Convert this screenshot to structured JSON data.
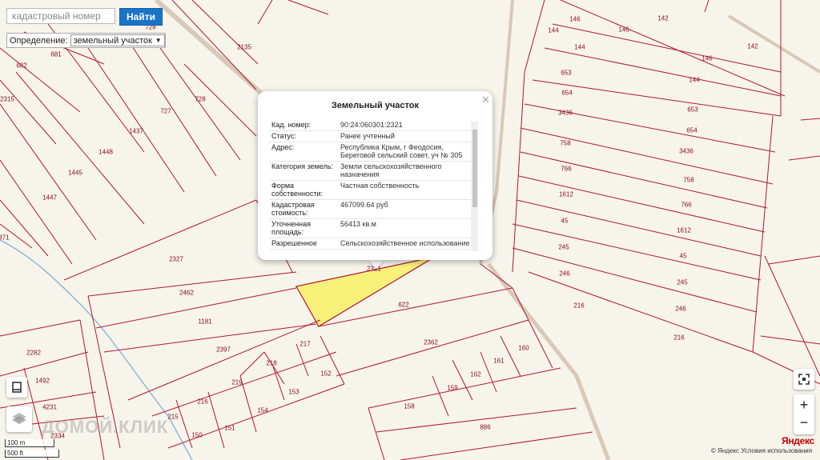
{
  "search": {
    "placeholder": "кадастровый номер",
    "button_label": "Найти"
  },
  "definition": {
    "label": "Определение:",
    "selected": "земельный участок"
  },
  "popup": {
    "title": "Земельный участок",
    "rows": [
      {
        "key": "Кад. номер:",
        "value": "90:24:060301:2321"
      },
      {
        "key": "Статус:",
        "value": "Ранее учтенный"
      },
      {
        "key": "Адрес:",
        "value": "Республика Крым, г Феодосия, Береговой сельский совет, уч № 305"
      },
      {
        "key": "Категория земель:",
        "value": "Земли сельскохозяйственного назначения"
      },
      {
        "key": "Форма собственности:",
        "value": "Частная собственность"
      },
      {
        "key": "Кадастровая стоимость:",
        "value": "467099.64 руб"
      },
      {
        "key": "Уточненная площадь:",
        "value": "56413 кв.м"
      },
      {
        "key": "Разрешенное",
        "value": "Сельскохозяйственное использование"
      }
    ]
  },
  "map_labels": [
    "2135",
    "728",
    "681",
    "682",
    "727",
    "728",
    "2315",
    "1437",
    "1448",
    "1445",
    "1447",
    "371",
    "2327",
    "2462",
    "1181",
    "2397",
    "217",
    "218",
    "219",
    "152",
    "153",
    "216",
    "154",
    "215",
    "150",
    "151",
    "2282",
    "1492",
    "4231",
    "2334",
    "2321",
    "622",
    "2362",
    "160",
    "161",
    "162",
    "159",
    "158",
    "886",
    "146",
    "142",
    "144",
    "146",
    "144",
    "146",
    "142",
    "653",
    "144",
    "654",
    "653",
    "3436",
    "654",
    "758",
    "3436",
    "766",
    "758",
    "1612",
    "766",
    "45",
    "1612",
    "245",
    "45",
    "246",
    "245",
    "216",
    "246",
    "216"
  ],
  "highlight_color": "#f7f17a",
  "parcel_line_color": "#b3162f",
  "scale": {
    "meters": "100 m",
    "feet": "500 ft"
  },
  "watermark": "ДОМОЙ.КЛИК",
  "copyright": "© Яндекс  Условия использования",
  "logo": "Яндекс",
  "controls": {
    "zoom_in": "+",
    "zoom_out": "−"
  }
}
